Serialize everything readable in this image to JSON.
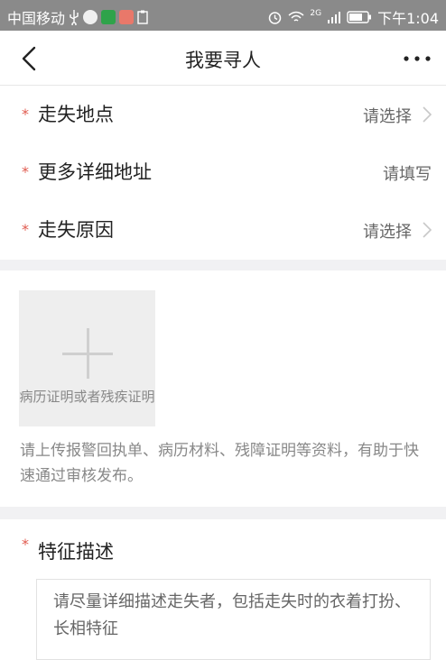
{
  "status_bar": {
    "carrier": "中国移动",
    "network": "2G",
    "time": "下午1:04"
  },
  "nav": {
    "title": "我要寻人"
  },
  "form": {
    "rows": [
      {
        "label": "走失地点",
        "value": "请选择"
      },
      {
        "label": "更多详细地址",
        "value": "请填写"
      },
      {
        "label": "走失原因",
        "value": "请选择"
      }
    ]
  },
  "upload": {
    "label": "病历证明或者残疾证明",
    "hint": "请上传报警回执单、病历材料、残障证明等资料，有助于快速通过审核发布。"
  },
  "description": {
    "title": "特征描述",
    "placeholder": "请尽量详细描述走失者，包括走失时的衣着打扮、长相特征"
  },
  "colors": {
    "required_star": "#e05a4e",
    "status_bar": "#8a8a8a",
    "section_gap": "#f1f1f3"
  }
}
